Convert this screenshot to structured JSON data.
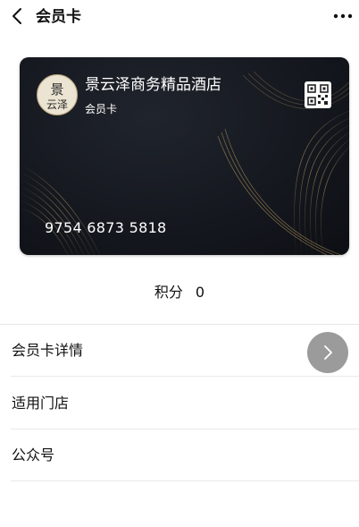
{
  "header": {
    "back_icon": "chevron-left-icon",
    "title": "会员卡",
    "more_icon": "more-dots-icon"
  },
  "card": {
    "hotel_name": "景云泽商务精品酒店",
    "card_type": "会员卡",
    "card_number": "9754 6873 5818",
    "logo_text": "景云泽",
    "qr_icon": "qr-code-icon",
    "colors": {
      "background": "#15181f",
      "accent": "#b89a5a",
      "text": "#ffffff"
    }
  },
  "points": {
    "label": "积分",
    "value": "0"
  },
  "menu": {
    "items": [
      {
        "label": "会员卡详情"
      },
      {
        "label": "适用门店"
      },
      {
        "label": "公众号"
      }
    ],
    "arrow_icon": "chevron-right-icon"
  }
}
